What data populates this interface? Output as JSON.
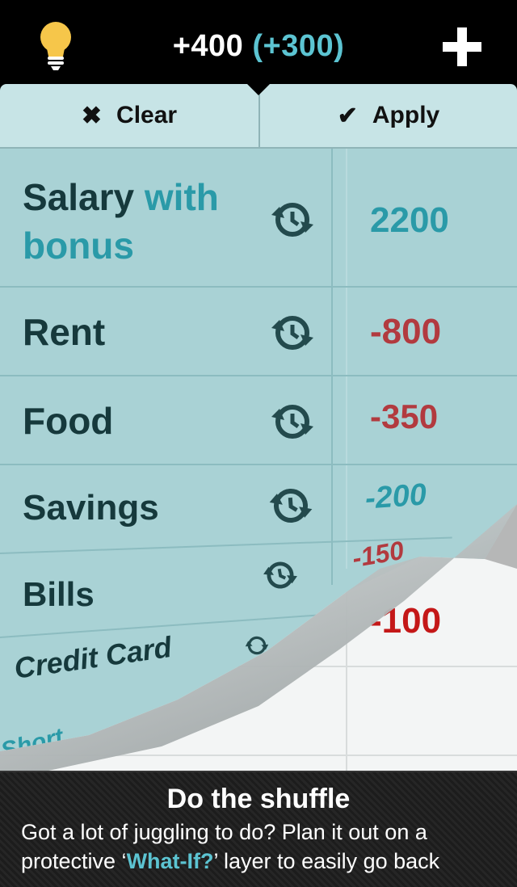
{
  "header": {
    "total": "+400",
    "delta": "(+300)"
  },
  "toolbar": {
    "clear_label": "Clear",
    "apply_label": "Apply"
  },
  "rows": [
    {
      "label_dark": "Salary",
      "label_accent": "with bonus",
      "value": "2200"
    },
    {
      "label": "Rent",
      "value": "-800"
    },
    {
      "label": "Food",
      "value": "-350"
    },
    {
      "label": "Savings",
      "value": "-200"
    },
    {
      "label": "Bills",
      "value": "-150"
    },
    {
      "label": "Credit Card",
      "value": "-100"
    },
    {
      "label": "Short"
    }
  ],
  "footer": {
    "title": "Do the shuffle",
    "body_pre": "Got a lot of juggling to do? Plan it out on a protective ‘",
    "body_highlight": "What-If?",
    "body_post": "’ layer to easily go back"
  },
  "colors": {
    "accent": "#2a9aa8",
    "negative": "#b23a3f",
    "sheet": "#a9d2d5"
  }
}
